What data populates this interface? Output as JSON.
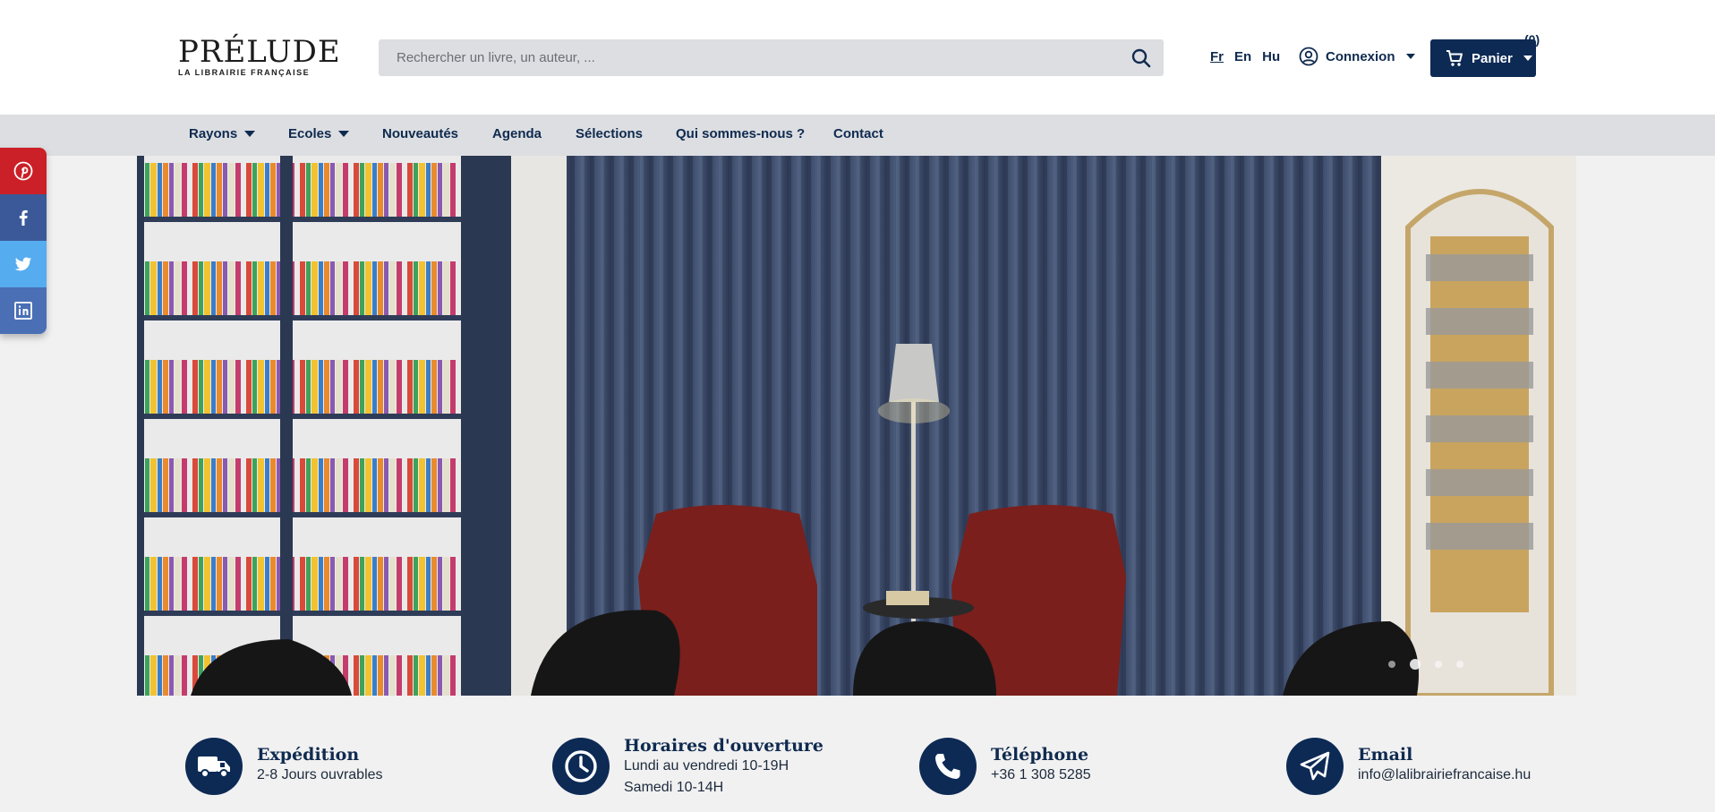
{
  "brand": {
    "name": "PRÉLUDE",
    "tagline": "LA LIBRAIRIE FRANÇAISE"
  },
  "search": {
    "placeholder": "Rechercher un livre, un auteur, ..."
  },
  "languages": [
    {
      "label": "Fr",
      "active": true
    },
    {
      "label": "En",
      "active": false
    },
    {
      "label": "Hu",
      "active": false
    }
  ],
  "account": {
    "login_label": "Connexion"
  },
  "cart": {
    "label": "Panier",
    "count": "(0)"
  },
  "nav": {
    "items": [
      {
        "label": "Rayons",
        "dropdown": true
      },
      {
        "label": "Ecoles",
        "dropdown": true
      },
      {
        "label": "Nouveautés",
        "dropdown": false
      },
      {
        "label": "Agenda",
        "dropdown": false
      },
      {
        "label": "Sélections",
        "dropdown": false
      },
      {
        "label": "Qui sommes-nous ?",
        "dropdown": false
      },
      {
        "label": "Contact",
        "dropdown": false
      }
    ]
  },
  "social": [
    "pinterest-icon",
    "facebook-icon",
    "twitter-icon",
    "linkedin-icon"
  ],
  "carousel": {
    "slides": 4,
    "active_slide": 2
  },
  "info": [
    {
      "icon": "truck-icon",
      "title": "Expédition",
      "lines": [
        "2-8 Jours ouvrables"
      ]
    },
    {
      "icon": "clock-icon",
      "title": "Horaires d'ouverture",
      "lines": [
        "Lundi au vendredi 10-19H",
        "Samedi 10-14H"
      ]
    },
    {
      "icon": "phone-icon",
      "title": "Téléphone",
      "lines": [
        "+36 1 308 5285"
      ]
    },
    {
      "icon": "paper-plane-icon",
      "title": "Email",
      "lines": [
        "info@lalibrairiefrancaise.hu"
      ]
    }
  ],
  "colors": {
    "navy": "#0d2a55",
    "nav_bg": "#dcdee1",
    "page_bg": "#f1f1f1"
  }
}
